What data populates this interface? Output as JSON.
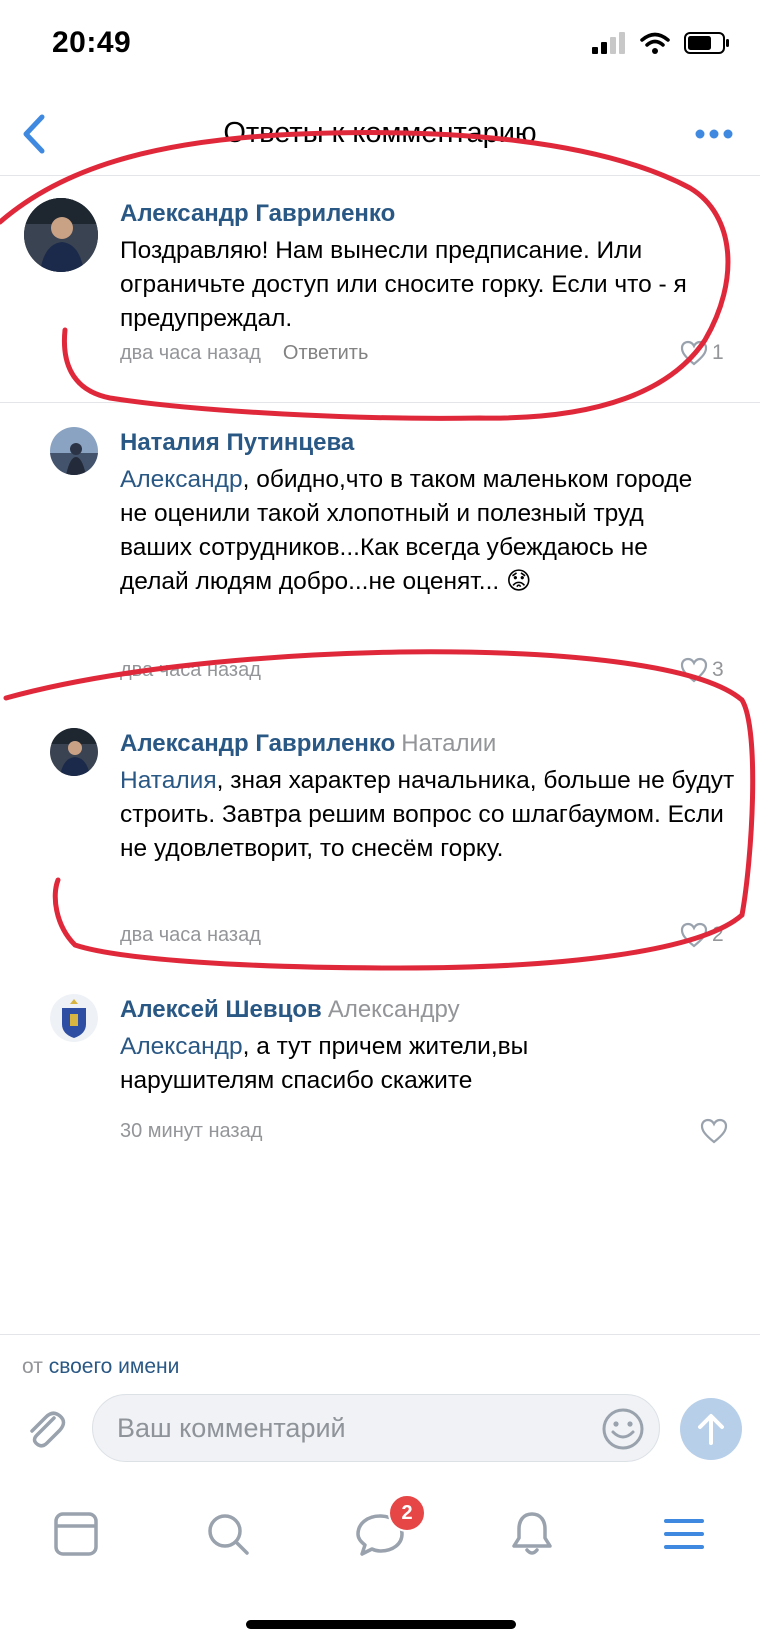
{
  "status_bar": {
    "time": "20:49"
  },
  "header": {
    "title": "Ответы к комментарию"
  },
  "comments": [
    {
      "author": "Александр Гавриленко",
      "reply_to": "",
      "mention": "",
      "text": "Поздравляю! Нам вынесли предписание. Или ограничьте доступ или сносите горку. Если что - я предупреждал.",
      "time": "два часа назад",
      "answer": "Ответить",
      "likes": "1"
    },
    {
      "author": "Наталия Путинцева",
      "reply_to": "",
      "mention": "Александр",
      "text": ", обидно,что в таком маленьком городе не оценили такой хлопотный и полезный труд ваших сотрудников...Как всегда убеждаюсь не делай людям добро...не оценят...",
      "emoji": "😟",
      "time": "два часа назад",
      "likes": "3"
    },
    {
      "author": "Александр Гавриленко",
      "reply_to": "Наталии",
      "mention": "Наталия",
      "text": ", зная характер начальника, больше не будут строить. Завтра решим вопрос со шлагбаумом. Если не удовлетворит, то снесём горку.",
      "time": "два часа назад",
      "likes": "2"
    },
    {
      "author": "Алексей Шевцов",
      "reply_to": "Александру",
      "mention": "Александр",
      "text": ", а тут причем жители,вы нарушителям спасибо скажите",
      "time": "30 минут назад",
      "likes": ""
    }
  ],
  "composer": {
    "from_prefix": "от",
    "from_link": "своего имени",
    "placeholder": "Ваш комментарий"
  },
  "tabbar": {
    "messages_badge": "2"
  },
  "colors": {
    "link": "#2a5885",
    "muted": "#939598",
    "annotation": "#e0283b",
    "send": "#b7cfe9"
  },
  "icons": [
    "back-chevron-icon",
    "more-dots-icon",
    "heart-icon",
    "paperclip-icon",
    "emoji-icon",
    "send-arrow-icon",
    "newsfeed-icon",
    "search-icon",
    "messages-icon",
    "bell-icon",
    "menu-icon"
  ]
}
